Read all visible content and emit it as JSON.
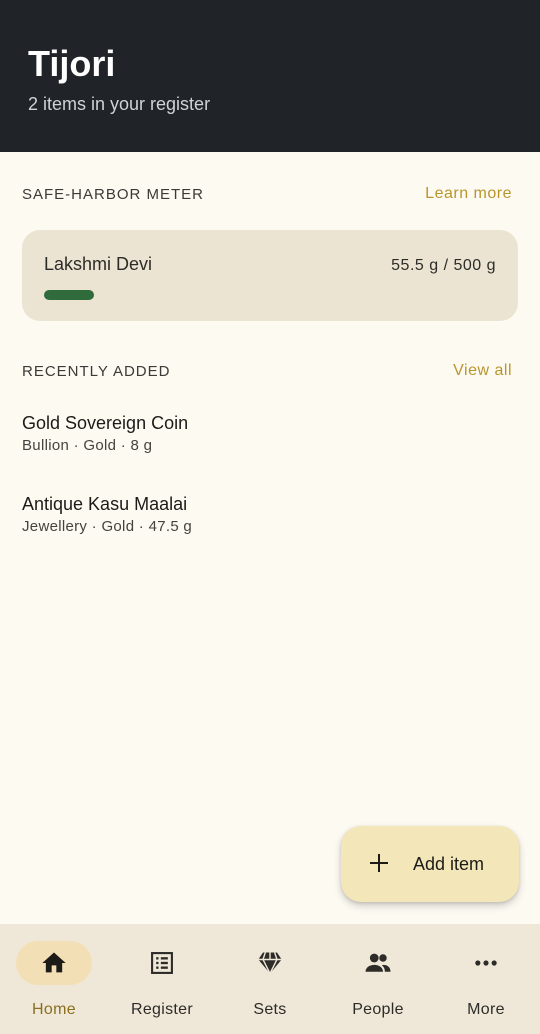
{
  "header": {
    "title": "Tijori",
    "subtitle": "2 items in your register"
  },
  "safe_harbor": {
    "section_title": "SAFE-HARBOR METER",
    "link_label": "Learn more",
    "person": "Lakshmi Devi",
    "value_text": "55.5 g / 500 g",
    "progress_fraction": 0.111,
    "bar_color": "#2f6b3b"
  },
  "recent": {
    "section_title": "RECENTLY ADDED",
    "link_label": "View all",
    "items": [
      {
        "title": "Gold Sovereign Coin",
        "meta": "Bullion · Gold · 8 g"
      },
      {
        "title": "Antique Kasu Maalai",
        "meta": "Jewellery · Gold · 47.5 g"
      }
    ]
  },
  "fab": {
    "icon": "plus-icon",
    "label": "Add item"
  },
  "bottom_nav": {
    "active": "Home",
    "items": [
      {
        "label": "Home",
        "icon": "home-icon"
      },
      {
        "label": "Register",
        "icon": "list-icon"
      },
      {
        "label": "Sets",
        "icon": "diamond-icon"
      },
      {
        "label": "People",
        "icon": "people-icon"
      },
      {
        "label": "More",
        "icon": "more-horizontal-icon"
      }
    ]
  },
  "colors": {
    "header_bg": "#202327",
    "page_bg": "#fdfaf2",
    "accent_link": "#b8962e",
    "card_bg": "#ebe4d3",
    "fab_bg": "#f3e6b8",
    "nav_bg": "#efe8d8",
    "nav_active_pill": "#f3dfb5"
  }
}
